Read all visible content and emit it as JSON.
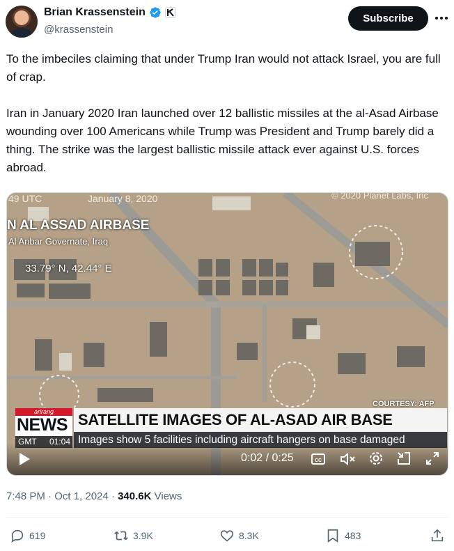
{
  "author": {
    "display_name": "Brian Krassenstein",
    "handle": "@krassenstein",
    "verified_color": "#1d9bf0"
  },
  "header": {
    "subscribe_label": "Subscribe",
    "more_icon": "more-icon"
  },
  "tweet": {
    "paragraph_1": "To the imbeciles claiming that under Trump Iran would not attack Israel, you are full of crap.",
    "paragraph_2": "Iran in January 2020 Iran launched over 12 ballistic missiles at the al-Asad Airbase wounding over 100 Americans while Trump was President and Trump barely did a thing. The strike was the largest ballistic missile attack ever against U.S. forces abroad."
  },
  "video": {
    "overlay_utc": "49 UTC",
    "overlay_date": "January 8, 2020",
    "overlay_copyright": "© 2020 Planet Labs, Inc",
    "overlay_base": "N AL ASSAD AIRBASE",
    "overlay_governate": "Al Anbar Governate, Iraq",
    "overlay_coords": "33.79° N, 42.44° E",
    "overlay_courtesy": "COURTESY: AFP PHOTO",
    "news_brand": "arirang",
    "news_word": "NEWS",
    "news_gmt_label": "GMT",
    "news_gmt_time": "01:04",
    "headline": "SATELLITE IMAGES OF AL-ASAD AIR BASE",
    "subline": "Images show 5 facilities including aircraft hangers on base damaged",
    "time": "0:02 / 0:25"
  },
  "meta": {
    "time_date": "7:48 PM · Oct 1, 2024 · ",
    "views_count": "340.6K",
    "views_label": " Views"
  },
  "actions": {
    "replies": "619",
    "reposts": "3.9K",
    "likes": "8.3K",
    "bookmarks": "483"
  }
}
